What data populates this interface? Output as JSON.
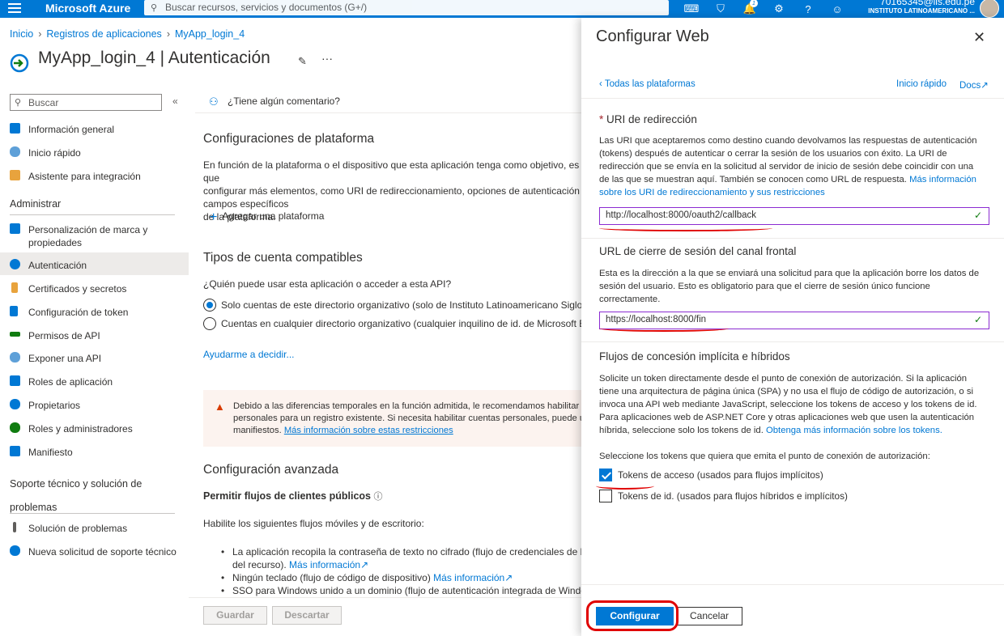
{
  "topbar": {
    "brand": "Microsoft Azure",
    "search_placeholder": "Buscar recursos, servicios y documentos (G+/)",
    "notification_count": "1",
    "account_email": "70165345@ils.edu.pe",
    "account_org": "INSTITUTO LATINOAMERICANO ..."
  },
  "breadcrumb": [
    "Inicio",
    "Registros de aplicaciones",
    "MyApp_login_4"
  ],
  "page": {
    "app_name": "MyApp_login_4",
    "separator": " | ",
    "section": "Autenticación"
  },
  "nav": {
    "search_placeholder": "Buscar",
    "collapse": "«",
    "items_top": [
      {
        "label": "Información general",
        "icon": "overview-icon",
        "color": "#0078d4"
      },
      {
        "label": "Inicio rápido",
        "icon": "cloud-icon",
        "color": "#0078d4"
      },
      {
        "label": "Asistente para integración",
        "icon": "rocket-icon",
        "color": "#e8a33d"
      }
    ],
    "header_admin": "Administrar",
    "items_admin": [
      {
        "label": "Personalización de marca y",
        "label2": "propiedades",
        "icon": "branding-icon",
        "color": "#0078d4"
      },
      {
        "label": "Autenticación",
        "icon": "authentication-icon",
        "color": "#0078d4"
      },
      {
        "label": "Certificados y secretos",
        "icon": "key-icon",
        "color": "#e8a33d"
      },
      {
        "label": "Configuración de token",
        "icon": "token-config-icon",
        "color": "#0078d4"
      },
      {
        "label": "Permisos de API",
        "icon": "api-permissions-icon",
        "color": "#107c10"
      },
      {
        "label": "Exponer una API",
        "icon": "cloud-api-icon",
        "color": "#0078d4"
      },
      {
        "label": "Roles de aplicación",
        "icon": "app-roles-icon",
        "color": "#0078d4"
      },
      {
        "label": "Propietarios",
        "icon": "owners-icon",
        "color": "#0078d4"
      },
      {
        "label": "Roles y administradores",
        "icon": "roles-admins-icon",
        "color": "#107c10"
      },
      {
        "label": "Manifiesto",
        "icon": "manifest-icon",
        "color": "#0078d4"
      }
    ],
    "header_support": "Soporte técnico y solución de",
    "header_support2": "problemas",
    "items_support": [
      {
        "label": "Solución de problemas",
        "icon": "wrench-icon",
        "color": "#323130"
      },
      {
        "label": "Nueva solicitud de soporte técnico",
        "icon": "support-person-icon",
        "color": "#0078d4"
      }
    ]
  },
  "main": {
    "feedback": "¿Tiene algún comentario?",
    "platform_title": "Configuraciones de plataforma",
    "platform_desc1": "En función de la plataforma o el dispositivo que esta aplicación tenga como objetivo, es posible que haya que",
    "platform_desc2": "configurar más elementos, como URI de redireccionamiento, opciones de autenticación específicas o campos específicos",
    "platform_desc3": "de la plataforma.",
    "add_platform": "Agregar una plataforma",
    "account_title": "Tipos de cuenta compatibles",
    "account_question": "¿Quién puede usar esta aplicación o acceder a esta API?",
    "radio1": "Solo cuentas de este directorio organizativo (solo de Instituto Latinoamericano Siglo XXI: inquilino único)",
    "radio2": "Cuentas en cualquier directorio organizativo (cualquier inquilino de id. de Microsoft Entra: multiinquilino)",
    "help_decide": "Ayudarme a decidir...",
    "warn1": "Debido a las diferencias temporales en la función admitida, le recomendamos habilitar las cuentas",
    "warn2": "personales para un registro existente. Si necesita habilitar cuentas personales, puede usar el editor de",
    "warn3": "manifiestos.",
    "warn_link": "Más información sobre estas restricciones",
    "advanced_title": "Configuración avanzada",
    "public_flows": "Permitir flujos de clientes públicos",
    "public_flows_info": "ⓘ",
    "enable_flows": "Habilite los siguientes flujos móviles y de escritorio:",
    "bullet1a": "La aplicación recopila la contraseña de texto no cifrado (flujo de credenciales de la contraseña del propietario",
    "bullet1b": "del recurso).",
    "bullet1_link": "Más información",
    "bullet2": "Ningún teclado (flujo de código de dispositivo)",
    "bullet2_link": "Más información",
    "bullet3": "SSO para Windows unido a un dominio (flujo de autenticación integrada de Windows)",
    "save": "Guardar",
    "discard": "Descartar"
  },
  "panel": {
    "title": "Configurar Web",
    "back": "Todas las plataformas",
    "quickstart": "Inicio rápido",
    "docs": "Docs",
    "redirect_required": "*",
    "redirect_title": "URI de redirección",
    "redirect_desc1": "Las URI que aceptaremos como destino cuando devolvamos las respuestas de autenticación",
    "redirect_desc2": "(tokens) después de autenticar o cerrar la sesión de los usuarios con éxito. La URI de",
    "redirect_desc3": "redirección que se envía en la solicitud al servidor de inicio de sesión debe coincidir con una",
    "redirect_desc4": "de las que se muestran aquí. También se conocen como URL de respuesta.",
    "redirect_link1": "Más información",
    "redirect_link2": "sobre los URI de redireccionamiento y sus restricciones",
    "redirect_value": "http://localhost:8000/oauth2/callback",
    "logout_title": "URL de cierre de sesión del canal frontal",
    "logout_desc1": "Esta es la dirección a la que se enviará una solicitud para que la aplicación borre los datos de",
    "logout_desc2": "sesión del usuario. Esto es obligatorio para que el cierre de sesión único funcione",
    "logout_desc3": "correctamente.",
    "logout_value": "https://localhost:8000/fin",
    "implicit_title": "Flujos de concesión implícita e híbridos",
    "implicit_desc1": "Solicite un token directamente desde el punto de conexión de autorización. Si la aplicación",
    "implicit_desc2": "tiene una arquitectura de página única (SPA) y no usa el flujo de código de autorización, o si",
    "implicit_desc3": "invoca una API web mediante JavaScript, seleccione los tokens de acceso y los tokens de id.",
    "implicit_desc4": "Para aplicaciones web de ASP.NET Core y otras aplicaciones web que usen la autenticación",
    "implicit_desc5": "híbrida, seleccione solo los tokens de id.",
    "implicit_link": "Obtenga más información sobre los tokens.",
    "select_tokens": "Seleccione los tokens que quiera que emita el punto de conexión de autorización:",
    "access_tokens": "Tokens de acceso (usados para flujos implícitos)",
    "access_checked": true,
    "id_tokens": "Tokens de id. (usados para flujos híbridos e implícitos)",
    "id_checked": false,
    "configure": "Configurar",
    "cancel": "Cancelar"
  },
  "colors": {
    "accent": "#0078d4",
    "annotation": "#e00000",
    "field_border": "#8b2bd1"
  }
}
